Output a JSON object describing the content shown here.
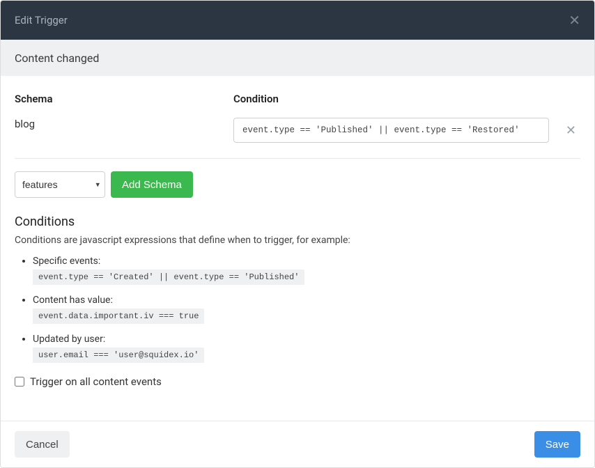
{
  "titlebar": {
    "title": "Edit Trigger"
  },
  "subheader": {
    "text": "Content changed"
  },
  "columns": {
    "schema_label": "Schema",
    "condition_label": "Condition"
  },
  "row": {
    "schema_name": "blog",
    "condition_value": "event.type == 'Published' || event.type == 'Restored'"
  },
  "add": {
    "select_value": "features",
    "button_label": "Add Schema"
  },
  "conditions_section": {
    "heading": "Conditions",
    "hint": "Conditions are javascript expressions that define when to trigger, for example:",
    "examples": [
      {
        "label": "Specific events:",
        "code": "event.type == 'Created' || event.type == 'Published'"
      },
      {
        "label": "Content has value:",
        "code": "event.data.important.iv === true"
      },
      {
        "label": "Updated by user:",
        "code": "user.email === 'user@squidex.io'"
      }
    ]
  },
  "trigger_all": {
    "label": "Trigger on all content events",
    "checked": false
  },
  "footer": {
    "cancel_label": "Cancel",
    "save_label": "Save"
  }
}
